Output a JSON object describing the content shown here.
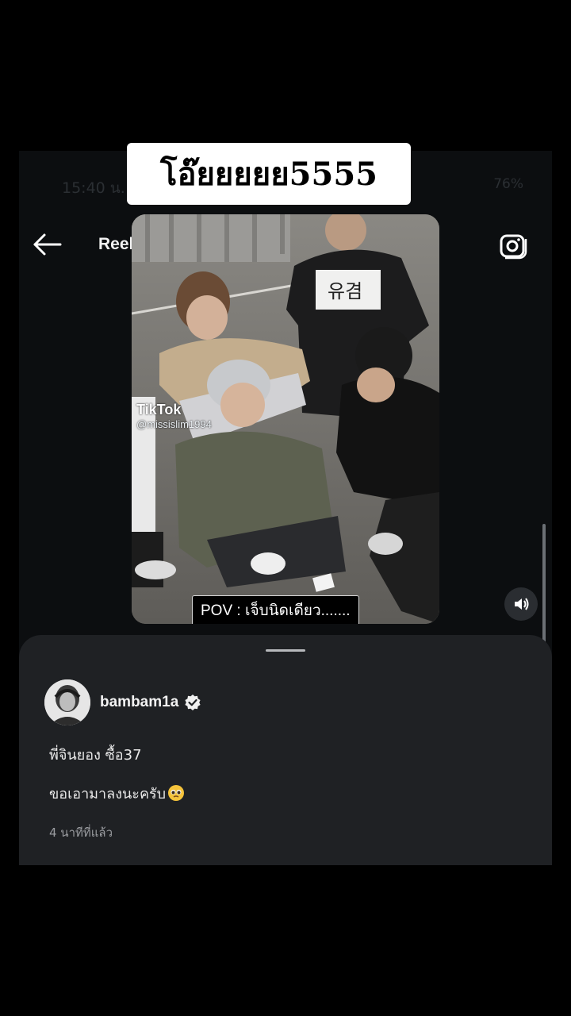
{
  "overlay": {
    "caption": "โอ๊ยยยยย5555"
  },
  "status_bar": {
    "time": "15:40 น.",
    "battery": "76%"
  },
  "nav": {
    "title": "Reels"
  },
  "video": {
    "watermark_brand": "TikTok",
    "watermark_user": "@missislim1994",
    "subtitle": "POV : เจ็บนิดเดียว......."
  },
  "post": {
    "username": "bambam1a",
    "caption_line1": "พี่จินยอง ซื้อ37",
    "caption_line2": "ขอเอามาลงนะครับ",
    "timestamp": "4 นาทีที่แล้ว"
  },
  "icons": {
    "back": "back-arrow-icon",
    "camera": "camera-icon",
    "volume": "volume-icon",
    "verified": "verified-badge-icon",
    "emoji": "pleading-face-emoji"
  }
}
